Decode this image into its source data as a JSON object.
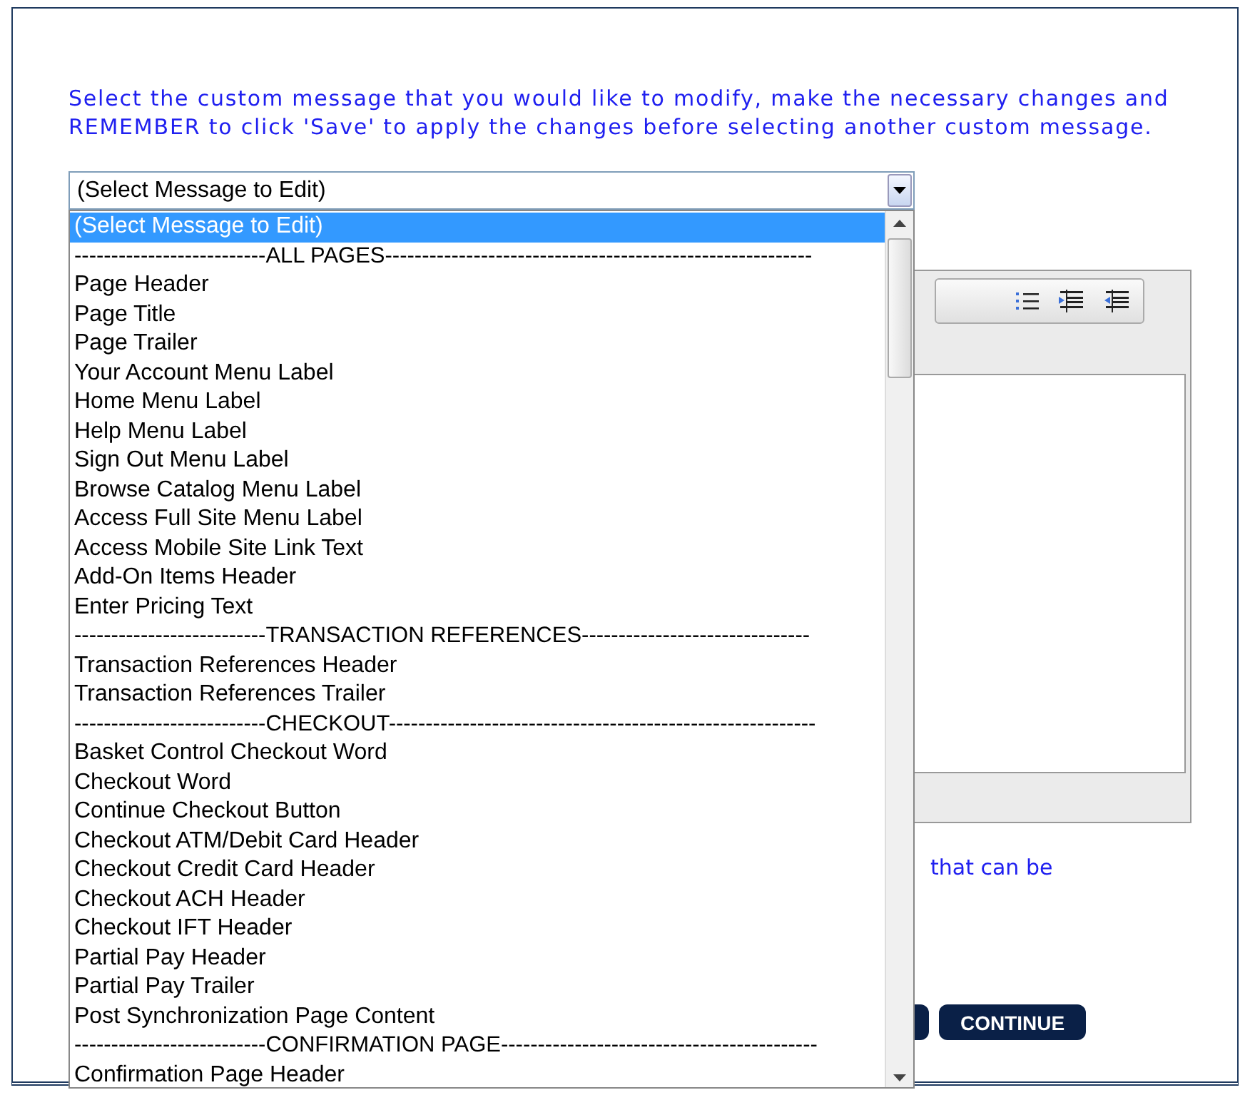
{
  "instructions": "Select the custom message that you would like to modify, make the necessary changes and REMEMBER to click 'Save' to apply the changes before selecting another custom message.",
  "message_select": {
    "value": "(Select Message to Edit)",
    "expanded": true,
    "options": [
      {
        "kind": "option",
        "label": "(Select Message to Edit)",
        "selected": true
      },
      {
        "kind": "separator",
        "label": "--------------------------ALL PAGES----------------------------------------------------------",
        "selected": false
      },
      {
        "kind": "option",
        "label": "Page Header",
        "selected": false
      },
      {
        "kind": "option",
        "label": "Page Title",
        "selected": false
      },
      {
        "kind": "option",
        "label": "Page Trailer",
        "selected": false
      },
      {
        "kind": "option",
        "label": "Your Account Menu Label",
        "selected": false
      },
      {
        "kind": "option",
        "label": "Home Menu Label",
        "selected": false
      },
      {
        "kind": "option",
        "label": "Help Menu Label",
        "selected": false
      },
      {
        "kind": "option",
        "label": "Sign Out Menu Label",
        "selected": false
      },
      {
        "kind": "option",
        "label": "Browse Catalog Menu Label",
        "selected": false
      },
      {
        "kind": "option",
        "label": "Access Full Site Menu Label",
        "selected": false
      },
      {
        "kind": "option",
        "label": "Access Mobile Site Link Text",
        "selected": false
      },
      {
        "kind": "option",
        "label": "Add-On Items Header",
        "selected": false
      },
      {
        "kind": "option",
        "label": "Enter Pricing Text",
        "selected": false
      },
      {
        "kind": "separator",
        "label": "--------------------------TRANSACTION REFERENCES-------------------------------",
        "selected": false
      },
      {
        "kind": "option",
        "label": "Transaction References Header",
        "selected": false
      },
      {
        "kind": "option",
        "label": "Transaction References Trailer",
        "selected": false
      },
      {
        "kind": "separator",
        "label": "--------------------------CHECKOUT----------------------------------------------------------",
        "selected": false
      },
      {
        "kind": "option",
        "label": "Basket Control Checkout Word",
        "selected": false
      },
      {
        "kind": "option",
        "label": "Checkout Word",
        "selected": false
      },
      {
        "kind": "option",
        "label": "Continue Checkout Button",
        "selected": false
      },
      {
        "kind": "option",
        "label": "Checkout ATM/Debit Card Header",
        "selected": false
      },
      {
        "kind": "option",
        "label": "Checkout Credit Card Header",
        "selected": false
      },
      {
        "kind": "option",
        "label": "Checkout ACH Header",
        "selected": false
      },
      {
        "kind": "option",
        "label": "Checkout IFT Header",
        "selected": false
      },
      {
        "kind": "option",
        "label": "Partial Pay Header",
        "selected": false
      },
      {
        "kind": "option",
        "label": "Partial Pay Trailer",
        "selected": false
      },
      {
        "kind": "option",
        "label": "Post Synchronization Page Content",
        "selected": false
      },
      {
        "kind": "separator",
        "label": "--------------------------CONFIRMATION PAGE-------------------------------------------",
        "selected": false
      },
      {
        "kind": "option",
        "label": "Confirmation Page Header",
        "selected": false
      }
    ]
  },
  "note_fragment": "that can be",
  "buttons": [
    {
      "label": "CONTINUE"
    }
  ]
}
